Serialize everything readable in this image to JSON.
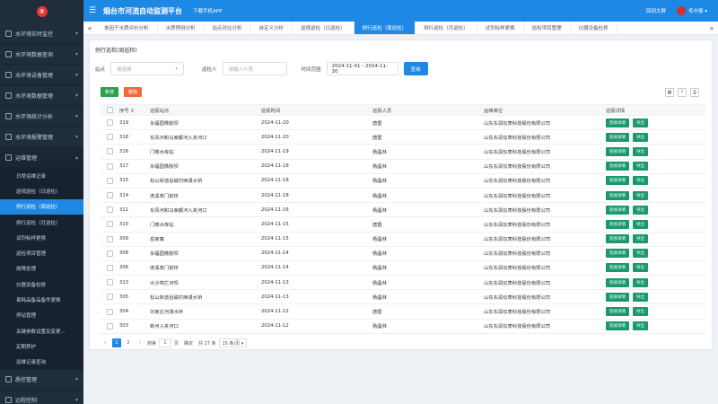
{
  "sidebar": {
    "logo_text": "②",
    "groups_top": [
      {
        "label": "水环境实时监控"
      },
      {
        "label": "水环境数据查询"
      },
      {
        "label": "水环境设备管理"
      },
      {
        "label": "水环境数据管理"
      },
      {
        "label": "水环境统计分析"
      },
      {
        "label": "水环境报警管理"
      }
    ],
    "open_group": {
      "label": "运维管理"
    },
    "sub_items": [
      {
        "label": "日常运维记录",
        "active": false
      },
      {
        "label": "巡视巡检（日巡检）",
        "active": false
      },
      {
        "label": "例行巡检（周巡检）",
        "active": true
      },
      {
        "label": "例行巡检（月巡检）",
        "active": false
      },
      {
        "label": "试剂标样更换",
        "active": false
      },
      {
        "label": "巡检项目管理",
        "active": false
      },
      {
        "label": "故障处理",
        "active": false
      },
      {
        "label": "仪器设备检修",
        "active": false
      },
      {
        "label": "易耗品备品备件更换",
        "active": false
      },
      {
        "label": "停站管理",
        "active": false
      },
      {
        "label": "关键参数设置及变更...",
        "active": false
      },
      {
        "label": "定期养护",
        "active": false
      },
      {
        "label": "运维记录查询",
        "active": false
      }
    ],
    "groups_bottom": [
      {
        "label": "质控管理"
      },
      {
        "label": "远程控制"
      }
    ]
  },
  "topbar": {
    "title": "烟台市河流自动监测平台",
    "download": "下载手机APP",
    "big_screen": "回到大屏",
    "user": "毛中豪 ▾"
  },
  "tabs": {
    "prev": "«",
    "next": "»",
    "items": [
      {
        "label": "单因子水质评价分析",
        "active": false
      },
      {
        "label": "水质预测分析",
        "active": false
      },
      {
        "label": "站点对比分析",
        "active": false
      },
      {
        "label": "自定义分析",
        "active": false
      },
      {
        "label": "巡视巡检（日巡检）",
        "active": false
      },
      {
        "label": "例行巡检（周巡检）",
        "active": true
      },
      {
        "label": "例行巡检（月巡检）",
        "active": false
      },
      {
        "label": "试剂标样更换",
        "active": false
      },
      {
        "label": "巡检项目管理",
        "active": false
      },
      {
        "label": "仪器设备检修",
        "active": false
      }
    ]
  },
  "page": {
    "title": "例行巡检(周巡检)",
    "filters": {
      "site_label": "站点",
      "site_placeholder": "请选择",
      "person_label": "巡检人",
      "person_placeholder": "请输入人员",
      "range_label": "时间范围",
      "range_value": "2024-11-01 - 2024-11-30",
      "query": "查询"
    },
    "add": "新增",
    "delete": "删除",
    "tools": [
      "▦",
      "⭳",
      "⎙"
    ],
    "columns": {
      "no": "序号 ⇕",
      "site": "巡视站点",
      "time": "巡视时间",
      "person": "巡视人员",
      "unit": "运维单位",
      "ops": "巡视详情"
    },
    "op_detail": "巡视详情",
    "op_export": "导出",
    "rows": [
      {
        "no": "319",
        "site": "永福园橡胶坝",
        "time": "2024-11-20",
        "person": "唐雷",
        "unit": "山东东润仪表科技股份有限公司"
      },
      {
        "no": "318",
        "site": "东风河和马家都河入夹河口",
        "time": "2024-11-20",
        "person": "唐雷",
        "unit": "山东东润仪表科技股份有限公司"
      },
      {
        "no": "316",
        "site": "门楼水库站",
        "time": "2024-11-19",
        "person": "杨晶林",
        "unit": "山东东润仪表科技股份有限公司"
      },
      {
        "no": "317",
        "site": "永福园橡胶坝",
        "time": "2024-11-18",
        "person": "杨晶林",
        "unit": "山东东润仪表科技股份有限公司"
      },
      {
        "no": "315",
        "site": "松山街道后磁村西漫水桥",
        "time": "2024-11-18",
        "person": "杨晶林",
        "unit": "山东东润仪表科技股份有限公司"
      },
      {
        "no": "314",
        "site": "虎溪泉门前桥",
        "time": "2024-11-18",
        "person": "杨晶林",
        "unit": "山东东润仪表科技股份有限公司"
      },
      {
        "no": "311",
        "site": "东风河和马家都河入夹河口",
        "time": "2024-11-16",
        "person": "杨晶林",
        "unit": "山东东润仪表科技股份有限公司"
      },
      {
        "no": "310",
        "site": "门楼水库站",
        "time": "2024-11-15",
        "person": "唐雷",
        "unit": "山东东润仪表科技股份有限公司"
      },
      {
        "no": "309",
        "site": "岳家寨",
        "time": "2024-11-15",
        "person": "杨晶林",
        "unit": "山东东润仪表科技股份有限公司"
      },
      {
        "no": "308",
        "site": "永福园橡胶坝",
        "time": "2024-11-14",
        "person": "杨晶林",
        "unit": "山东东润仪表科技股份有限公司"
      },
      {
        "no": "306",
        "site": "虎溪泉门前桥",
        "time": "2024-11-14",
        "person": "杨晶林",
        "unit": "山东东润仪表科技股份有限公司"
      },
      {
        "no": "313",
        "site": "大沙埠拦河坝",
        "time": "2024-11-13",
        "person": "杨晶林",
        "unit": "山东东润仪表科技股份有限公司"
      },
      {
        "no": "305",
        "site": "松山街道后磁村西漫水桥",
        "time": "2024-11-13",
        "person": "杨晶林",
        "unit": "山东东润仪表科技股份有限公司"
      },
      {
        "no": "304",
        "site": "刘家庄河漫水桥",
        "time": "2024-11-12",
        "person": "唐雷",
        "unit": "山东东润仪表科技股份有限公司"
      },
      {
        "no": "303",
        "site": "新河入夹河口",
        "time": "2024-11-12",
        "person": "杨晶林",
        "unit": "山东东润仪表科技股份有限公司"
      }
    ],
    "pager": {
      "prev": "‹",
      "next": "›",
      "pages": [
        "1",
        "2"
      ],
      "goto_label": "到第",
      "goto_value": "1",
      "page_unit": "页",
      "confirm": "确定",
      "total": "共 27 条",
      "size": "15 条/页 ▾"
    }
  }
}
